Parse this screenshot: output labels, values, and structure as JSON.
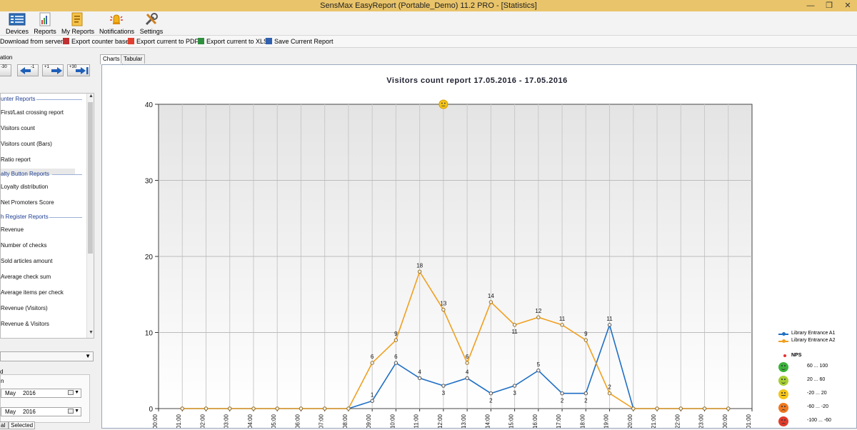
{
  "window": {
    "title": "SensMax EasyReport (Portable_Demo) 11.2 PRO - [Statistics]",
    "minimize_glyph": "—",
    "restore_glyph": "❐",
    "close_glyph": "✕"
  },
  "ribbon": {
    "buttons": [
      {
        "label": "Devices",
        "icon": "devices-icon"
      },
      {
        "label": "Reports",
        "icon": "reports-icon"
      },
      {
        "label": "My Reports",
        "icon": "my-reports-icon"
      },
      {
        "label": "Notifications",
        "icon": "notifications-icon"
      },
      {
        "label": "Settings",
        "icon": "settings-icon"
      }
    ]
  },
  "toolbar": {
    "download": "Download from server",
    "export_base": "Export counter base",
    "export_pdf": "Export current to PDF",
    "export_xls": "Export current to XLS",
    "save_report": "Save Current Report"
  },
  "navigation": {
    "caption": "ation",
    "buttons": [
      "-30",
      "-1",
      "+1",
      "+30"
    ]
  },
  "report_list": {
    "groups": [
      {
        "label": "unter Reports",
        "items": [
          "First/Last crossing report",
          "Visitors count",
          "Visitors count (Bars)",
          "Ratio report"
        ]
      },
      {
        "label": "alty Button Reports",
        "items": [
          "Loyalty distribution",
          "Net Promoters Score"
        ]
      },
      {
        "label": "h Register Reports",
        "items": [
          "Revenue",
          "Number of checks",
          "Sold articles amount",
          "Average check sum",
          "Average items per check",
          "Revenue (Visitors)",
          "Revenue & Visitors"
        ]
      }
    ],
    "selected": "Visitors count"
  },
  "period": {
    "label_a": "d",
    "label_b": "n",
    "from": {
      "month": "May",
      "year": "2016"
    },
    "to": {
      "month": "May",
      "year": "2016"
    }
  },
  "bottom_tabs": [
    "al",
    "Selected"
  ],
  "main_tabs": [
    "Charts",
    "Tabular"
  ],
  "chart_data": {
    "type": "line",
    "title": "Visitors count report 17.05.2016 - 17.05.2016",
    "xlabel": "",
    "ylabel": "",
    "ylim": [
      0,
      40
    ],
    "yticks": [
      0,
      10,
      20,
      30,
      40
    ],
    "grid": true,
    "legend_position": "right",
    "categories": [
      "00:00",
      "01:00",
      "02:00",
      "03:00",
      "04:00",
      "05:00",
      "06:00",
      "07:00",
      "08:00",
      "09:00",
      "10:00",
      "11:00",
      "12:00",
      "13:00",
      "14:00",
      "15:00",
      "16:00",
      "17:00",
      "18:00",
      "19:00",
      "20:00",
      "21:00",
      "22:00",
      "23:00",
      "00:00",
      "01:00"
    ],
    "series": [
      {
        "name": "Library Entrance A1",
        "color": "#1f6fc5",
        "values": [
          null,
          0,
          0,
          0,
          0,
          0,
          0,
          0,
          0,
          1,
          6,
          4,
          3,
          4,
          2,
          3,
          5,
          2,
          2,
          11,
          0,
          0,
          0,
          0,
          0,
          null
        ]
      },
      {
        "name": "Library Entrance A2",
        "color": "#f0a020",
        "values": [
          null,
          0,
          0,
          0,
          0,
          0,
          0,
          0,
          0,
          6,
          9,
          18,
          13,
          6,
          14,
          11,
          12,
          11,
          9,
          2,
          0,
          0,
          0,
          0,
          0,
          null
        ]
      }
    ],
    "nps_marker": {
      "category": "12:00",
      "value": 40,
      "face": "neutral"
    }
  },
  "legend": {
    "nps_title": "NPS",
    "nps_rows": [
      {
        "range": "60 ... 100",
        "color": "#3cb43c",
        "face": "happy"
      },
      {
        "range": "20 ... 60",
        "color": "#a6cf34",
        "face": "happy"
      },
      {
        "range": "-20 ... 20",
        "color": "#f5c518",
        "face": "neutral"
      },
      {
        "range": "-60 ... -20",
        "color": "#f07820",
        "face": "sad"
      },
      {
        "range": "-100 ... -60",
        "color": "#e23a2a",
        "face": "sad"
      }
    ]
  }
}
